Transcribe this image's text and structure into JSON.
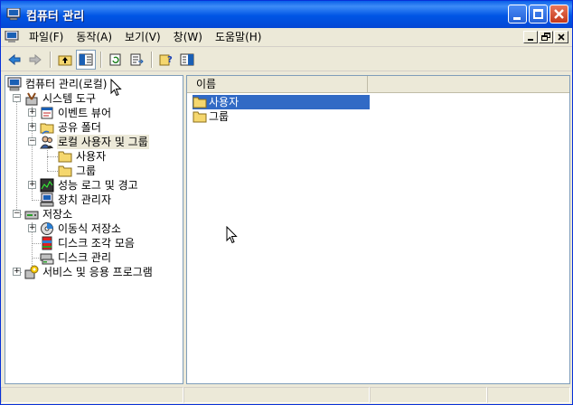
{
  "window": {
    "title": "컴퓨터 관리"
  },
  "menu": [
    "파일(F)",
    "동작(A)",
    "보기(V)",
    "창(W)",
    "도움말(H)"
  ],
  "toolbar": [
    "back-icon",
    "forward-icon",
    "up-folder-icon",
    "show-hide-tree-icon",
    "refresh-icon",
    "export-list-icon",
    "help-icon",
    "show-hide-action-pane-icon"
  ],
  "tree": {
    "root": "컴퓨터 관리(로컬)",
    "system_tools": "시스템 도구",
    "event_viewer": "이벤트 뷰어",
    "shared_folders": "공유 폴더",
    "local_users": "로컬 사용자 및 그룹",
    "users": "사용자",
    "groups": "그룹",
    "perf_logs": "성능 로그 및 경고",
    "device_manager": "장치 관리자",
    "storage": "저장소",
    "removable_storage": "이동식 저장소",
    "defrag": "디스크 조각 모음",
    "disk_mgmt": "디스크 관리",
    "services_apps": "서비스 및 응용 프로그램"
  },
  "list": {
    "column_name": "이름",
    "items": [
      "사용자",
      "그룹"
    ]
  },
  "colors": {
    "titlebar": "#0055e5",
    "selection": "#316ac5",
    "folder": "#f5d76e"
  }
}
